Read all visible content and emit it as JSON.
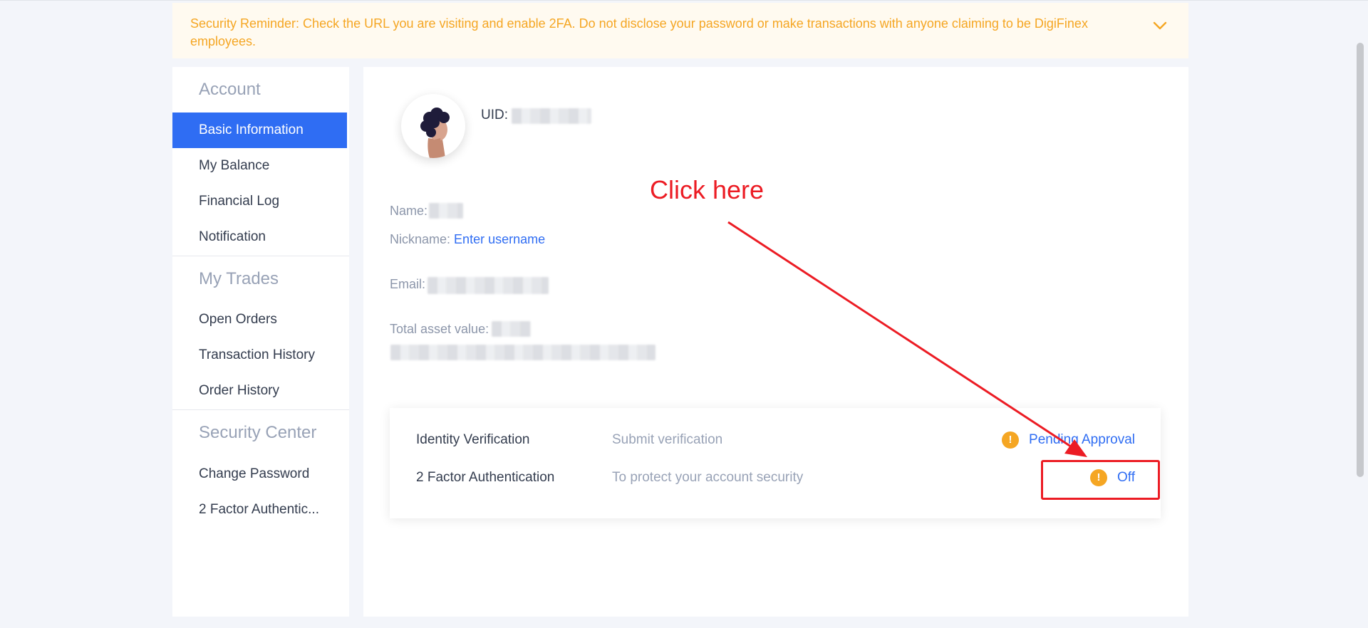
{
  "banner": {
    "text": "Security Reminder: Check the URL you are visiting and enable 2FA. Do not disclose your password or make transactions with anyone claiming to be DigiFinex employees.",
    "icon": "chevron-down-icon",
    "color": "#f5a623"
  },
  "sidebar": {
    "groups": [
      {
        "title": "Account",
        "items": [
          "Basic Information",
          "My Balance",
          "Financial Log",
          "Notification"
        ]
      },
      {
        "title": "My Trades",
        "items": [
          "Open Orders",
          "Transaction History",
          "Order History"
        ]
      },
      {
        "title": "Security Center",
        "items": [
          "Change Password",
          "2 Factor Authentic..."
        ]
      }
    ],
    "active_item": "Basic Information",
    "accent": "#2f6df3"
  },
  "profile": {
    "uid_label": "UID:",
    "name_label": "Name:",
    "nickname_label": "Nickname:",
    "nickname_link": "Enter username",
    "email_label": "Email:",
    "asset_label": "Total asset value:"
  },
  "security": {
    "rows": [
      {
        "title": "Identity Verification",
        "desc": "Submit verification",
        "status": "Pending Approval"
      },
      {
        "title": "2 Factor Authentication",
        "desc": "To protect your account security",
        "status": "Off"
      }
    ],
    "warn_color": "#f5a623"
  },
  "annotation": {
    "text": "Click here",
    "color": "#ec1c24"
  }
}
